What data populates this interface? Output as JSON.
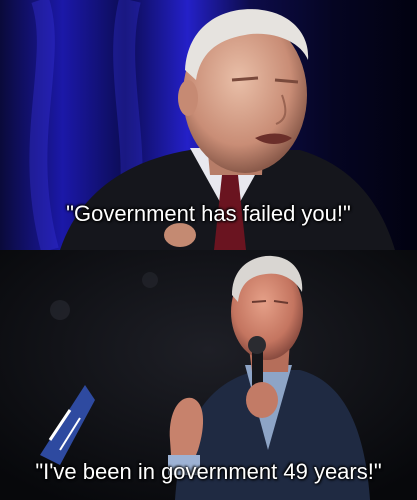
{
  "meme": {
    "top_panel": {
      "caption": "\"Government has failed you!\""
    },
    "bottom_panel": {
      "caption": "\"I've been in government 49 years!\""
    }
  }
}
